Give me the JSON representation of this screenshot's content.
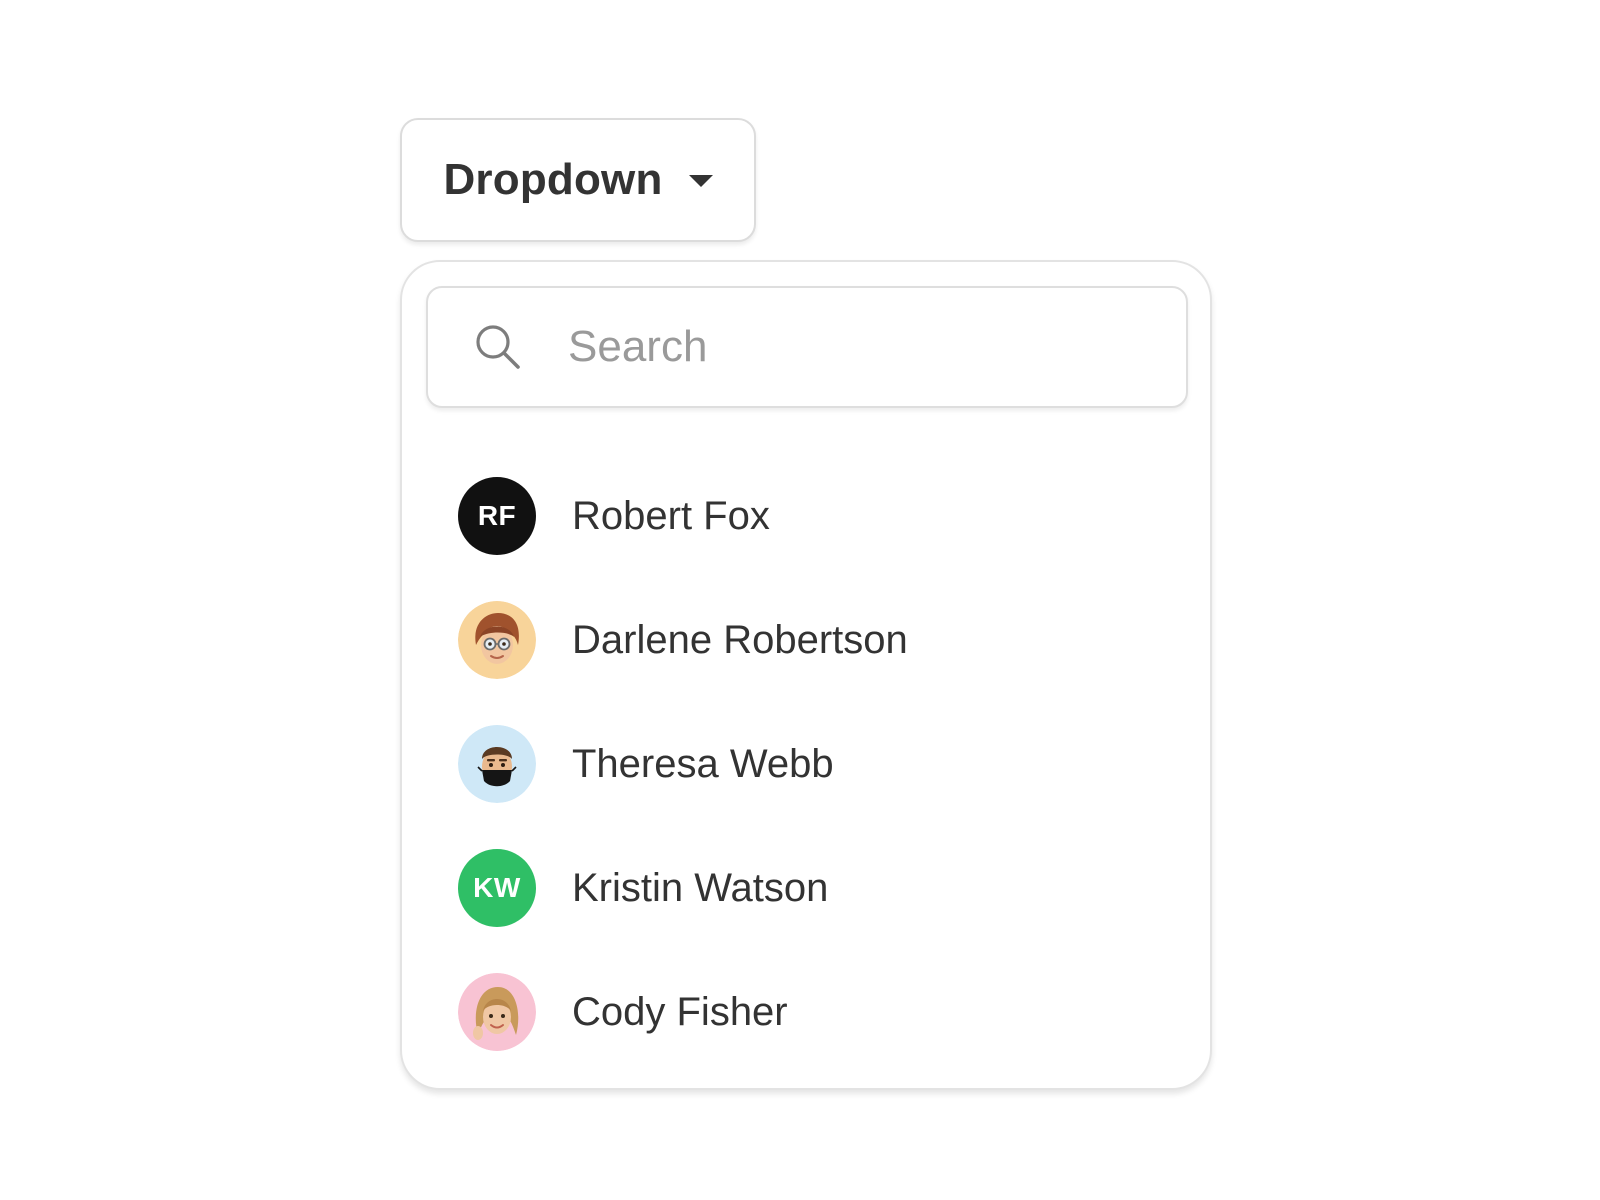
{
  "dropdown": {
    "label": "Dropdown",
    "caret_icon": "caret-down-icon"
  },
  "search": {
    "icon": "search-icon",
    "placeholder": "Search",
    "value": ""
  },
  "users": [
    {
      "name": "Robert Fox",
      "avatar_type": "initials",
      "initials": "RF",
      "avatar_color": "#111111"
    },
    {
      "name": "Darlene Robertson",
      "avatar_type": "memoji",
      "avatar_color": "#f8d49a"
    },
    {
      "name": "Theresa Webb",
      "avatar_type": "memoji",
      "avatar_color": "#cfe8f7"
    },
    {
      "name": "Kristin Watson",
      "avatar_type": "initials",
      "initials": "KW",
      "avatar_color": "#2fbf66"
    },
    {
      "name": "Cody Fisher",
      "avatar_type": "memoji",
      "avatar_color": "#f8c3d3"
    }
  ]
}
